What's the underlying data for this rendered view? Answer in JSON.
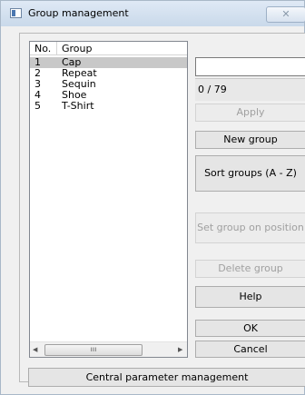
{
  "window": {
    "title": "Group management",
    "close_glyph": "✕"
  },
  "list": {
    "headers": {
      "no": "No.",
      "group": "Group"
    },
    "rows": [
      {
        "no": "1",
        "name": "Cap",
        "selected": true
      },
      {
        "no": "2",
        "name": "Repeat",
        "selected": false
      },
      {
        "no": "3",
        "name": "Sequin",
        "selected": false
      },
      {
        "no": "4",
        "name": "Shoe",
        "selected": false
      },
      {
        "no": "5",
        "name": "T-Shirt",
        "selected": false
      }
    ],
    "scroll": {
      "left_arrow": "◀",
      "right_arrow": "▶",
      "thumb_grip": "ııı"
    }
  },
  "editor": {
    "name_value": "",
    "counter": "0 / 79"
  },
  "buttons": {
    "apply": "Apply",
    "new_group": "New group",
    "sort": "Sort groups (A - Z)",
    "set_position": "Set group on position",
    "delete": "Delete group",
    "help": "Help",
    "ok": "OK",
    "cancel": "Cancel",
    "central": "Central parameter management"
  },
  "icons": {
    "app": "app-window-icon",
    "close": "close-icon"
  }
}
